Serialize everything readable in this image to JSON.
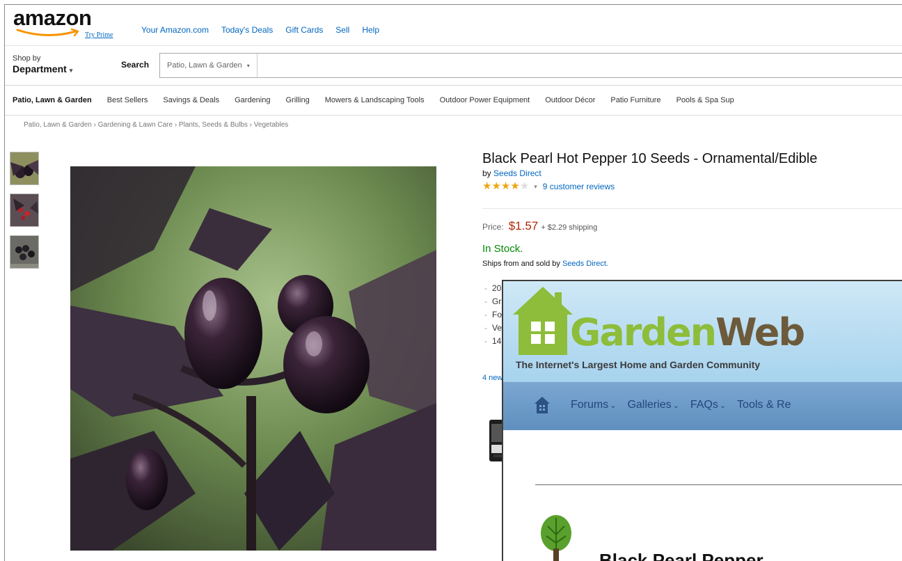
{
  "amazon": {
    "logo_text": "amazon",
    "try_prime": "Try Prime",
    "top_links": [
      "Your Amazon.com",
      "Today's Deals",
      "Gift Cards",
      "Sell",
      "Help"
    ],
    "shop_by_small": "Shop by",
    "shop_by_big": "Department",
    "search_label": "Search",
    "search_scope": "Patio, Lawn & Garden",
    "subnav": [
      "Patio, Lawn & Garden",
      "Best Sellers",
      "Savings & Deals",
      "Gardening",
      "Grilling",
      "Mowers & Landscaping Tools",
      "Outdoor Power Equipment",
      "Outdoor Décor",
      "Patio Furniture",
      "Pools & Spa Sup"
    ],
    "breadcrumb": [
      "Patio, Lawn & Garden",
      "Gardening & Lawn Care",
      "Plants, Seeds & Bulbs",
      "Vegetables"
    ],
    "product": {
      "title": "Black Pearl Hot Pepper 10 Seeds - Ornamental/Edible",
      "by_prefix": "by",
      "seller": "Seeds Direct",
      "rating_stars": 4,
      "reviews": "9 customer reviews",
      "price_label": "Price:",
      "price": "$1.57",
      "shipping": "+ $2.29 shipping",
      "stock": "In Stock.",
      "ships_text": "Ships from and sold by",
      "ships_seller": "Seeds Direct.",
      "bullets": [
        "20",
        "Gr",
        "Fo",
        "Ve",
        "14"
      ],
      "new_link": "4 new"
    },
    "colors": {
      "link": "#0066c0",
      "price": "#b12704",
      "in_stock": "#008a00",
      "stars": "#f0a511"
    }
  },
  "gardenweb": {
    "brand_garden": "Garden",
    "brand_web": "Web",
    "tagline": "The Internet's Largest Home and Garden Community",
    "nav": [
      "Forums",
      "Galleries",
      "FAQs",
      "Tools & Re"
    ],
    "heading": "Black Pearl Pepper",
    "colors": {
      "green": "#8dbd3a",
      "brown": "#6d5a3b",
      "nav_blue": "#6f9cc9"
    }
  }
}
